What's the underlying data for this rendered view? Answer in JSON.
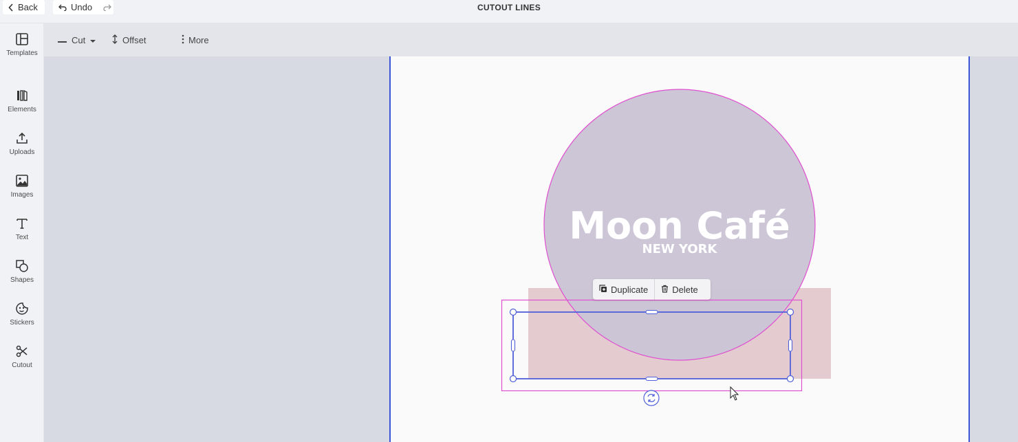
{
  "topbar": {
    "back_label": "Back",
    "undo_label": "Undo",
    "title": "CUTOUT LINES"
  },
  "sidebar": {
    "items": [
      {
        "label": "Templates",
        "icon": "templates-icon"
      },
      {
        "label": "Elements",
        "icon": "elements-icon"
      },
      {
        "label": "Uploads",
        "icon": "upload-icon"
      },
      {
        "label": "Images",
        "icon": "image-icon"
      },
      {
        "label": "Text",
        "icon": "text-icon"
      },
      {
        "label": "Shapes",
        "icon": "shapes-icon"
      },
      {
        "label": "Stickers",
        "icon": "sticker-icon"
      },
      {
        "label": "Cutout",
        "icon": "scissors-icon"
      }
    ]
  },
  "toolbar": {
    "cut_label": "Cut",
    "offset_label": "Offset",
    "more_label": "More"
  },
  "canvas": {
    "logo_title": "Moon Café",
    "logo_subtitle": "NEW YORK",
    "circle_fill": "#cbc4d6",
    "rect_fill": "#e3cbd0",
    "cutline_color": "#e04fd0",
    "selection_color": "#4f5fd9"
  },
  "context_menu": {
    "duplicate_label": "Duplicate",
    "delete_label": "Delete"
  }
}
